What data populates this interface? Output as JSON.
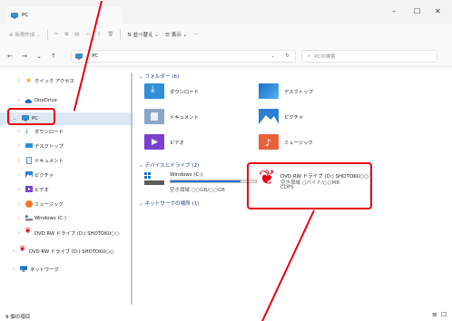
{
  "window": {
    "tab_title": "PC",
    "minimize": "–",
    "maximize": "☐",
    "close": "✕"
  },
  "toolbar": {
    "new": "新規作成",
    "sort": "並べ替え",
    "view": "表示",
    "more": "···"
  },
  "address": {
    "path": "PC",
    "search_placeholder": "PCの検索"
  },
  "sidebar": {
    "items": [
      {
        "label": "クイック アクセス"
      },
      {
        "label": "OneDrive"
      },
      {
        "label": "PC"
      },
      {
        "label": "ダウンロード"
      },
      {
        "label": "デスクトップ"
      },
      {
        "label": "ドキュメント"
      },
      {
        "label": "ピクチャ"
      },
      {
        "label": "ビデオ"
      },
      {
        "label": "ミュージック"
      },
      {
        "label": "Windows (C:)"
      },
      {
        "label": "DVD RW ドライブ (D:) SHOTOKU○○"
      },
      {
        "label": "DVD RW ドライブ (D:) SHOTOKU○○"
      },
      {
        "label": "ネットワーク"
      }
    ]
  },
  "main": {
    "folders_header": "フォルダー (6)",
    "folders": [
      {
        "label": "ダウンロード"
      },
      {
        "label": "デスクトップ"
      },
      {
        "label": "ドキュメント"
      },
      {
        "label": "ピクチャ"
      },
      {
        "label": "ビデオ"
      },
      {
        "label": "ミュージック"
      }
    ],
    "drives_header": "デバイスとドライブ (2)",
    "drive_c": {
      "name": "Windows (C:)",
      "free": "空き領域 ○○GB/○○GB",
      "used_fraction": 0.82
    },
    "drive_d": {
      "name": "DVD RW ドライブ (D:) SHOTOKU○○",
      "free": "空き領域 ○バイト/○○MB",
      "fs": "CDFS"
    },
    "network_header": "ネットワークの場所 (1)"
  },
  "status": {
    "count": "9 個の項目"
  },
  "colors": {
    "highlight_red": "#e60012",
    "folder_blue": "#2f8fd8",
    "progress_blue": "#1f73c8"
  }
}
